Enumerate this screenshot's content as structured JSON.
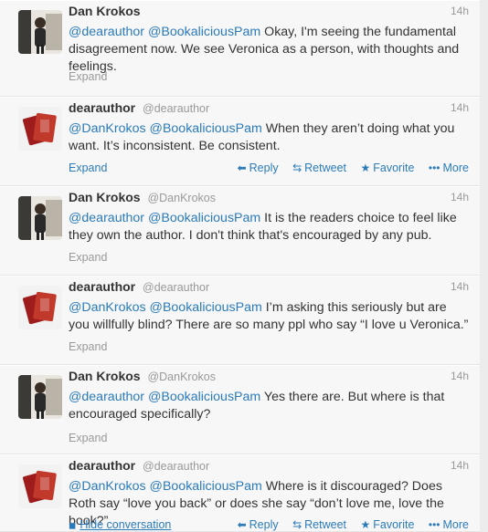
{
  "tweets": [
    {
      "fullname": "Dan Krokos",
      "username": "",
      "time": "14h",
      "mentions": [
        "@dearauthor",
        "@BookaliciousPam"
      ],
      "body": " Okay, I'm seeing the fundamental disagreement now. We see Veronica as a person, with thoughts and feelings.",
      "expand": "Expand"
    },
    {
      "fullname": "dearauthor",
      "username": "@dearauthor",
      "time": "14h",
      "mentions": [
        "@DanKrokos",
        "@BookaliciousPam"
      ],
      "body": " When they aren’t doing what you want. It’s inconsistent.  Be consistent.",
      "expand": "Expand",
      "actions": {
        "reply": "Reply",
        "retweet": "Retweet",
        "favorite": "Favorite",
        "more": "More"
      }
    },
    {
      "fullname": "Dan Krokos",
      "username": "@DanKrokos",
      "time": "14h",
      "mentions": [
        "@dearauthor",
        "@BookaliciousPam"
      ],
      "body": " It is the readers choice to feel like they own the author. I don't think that's encouraged by any pub.",
      "expand": "Expand"
    },
    {
      "fullname": "dearauthor",
      "username": "@dearauthor",
      "time": "14h",
      "mentions": [
        "@DanKrokos",
        "@BookaliciousPam"
      ],
      "body": " I’m asking this seriously but are you willfully blind? There are so many ppl who say “I love u Veronica.”",
      "expand": "Expand"
    },
    {
      "fullname": "Dan Krokos",
      "username": "@DanKrokos",
      "time": "14h",
      "mentions": [
        "@dearauthor",
        "@BookaliciousPam"
      ],
      "body": " Yes there are. But where is that encouraged specifically?",
      "expand": "Expand"
    },
    {
      "fullname": "dearauthor",
      "username": "@dearauthor",
      "time": "14h",
      "mentions": [
        "@DanKrokos",
        "@BookaliciousPam"
      ],
      "body": " Where is it discouraged? Does Roth say “love you back” or does she say “don’t love me, love the book?”",
      "expand": "Hide conversation",
      "actions": {
        "reply": "Reply",
        "retweet": "Retweet",
        "favorite": "Favorite",
        "more": "More"
      }
    }
  ],
  "colors": {
    "link": "#2b7bb9",
    "muted": "#999999",
    "text": "#333333"
  },
  "icons": {
    "reply": "reply-arrow-icon",
    "retweet": "retweet-icon",
    "favorite": "star-icon",
    "more": "dots-icon",
    "hide": "conversation-icon"
  }
}
